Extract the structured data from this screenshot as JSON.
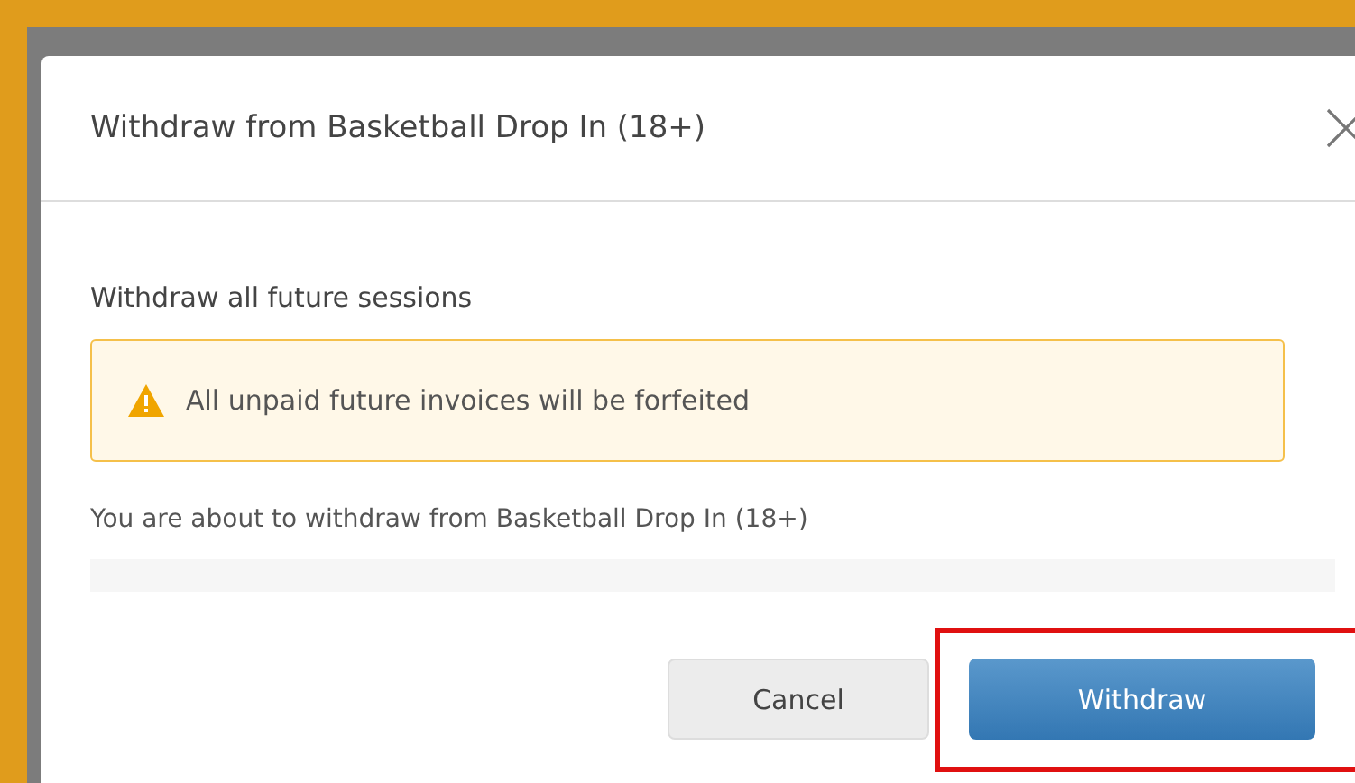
{
  "dialog": {
    "title": "Withdraw from Basketball Drop In (18+)",
    "section_label": "Withdraw all future sessions",
    "alert": {
      "kind": "warning",
      "text": "All unpaid future invoices will be forfeited"
    },
    "message": "You are about to withdraw from Basketball Drop In (18+)",
    "buttons": [
      {
        "label": "Cancel",
        "kind": "secondary",
        "highlighted": false
      },
      {
        "label": "Withdraw",
        "kind": "primary",
        "highlighted": true
      }
    ]
  }
}
